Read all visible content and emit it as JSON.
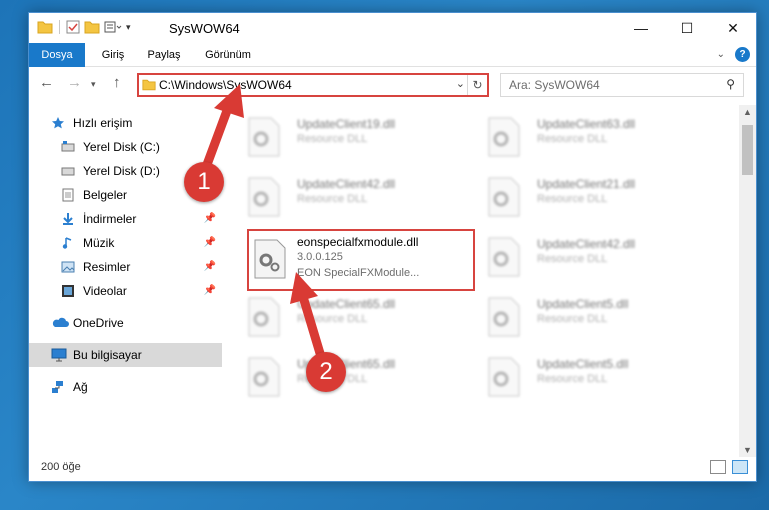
{
  "window": {
    "title": "SysWOW64"
  },
  "ribbon": {
    "tabs": [
      "Dosya",
      "Giriş",
      "Paylaş",
      "Görünüm"
    ]
  },
  "address": {
    "path": "C:\\Windows\\SysWOW64"
  },
  "search": {
    "placeholder": "Ara: SysWOW64"
  },
  "sidebar": {
    "items": [
      {
        "label": "Hızlı erişim",
        "icon": "star-icon"
      },
      {
        "label": "Yerel Disk (C:)",
        "icon": "drive-icon"
      },
      {
        "label": "Yerel Disk (D:)",
        "icon": "drive-icon"
      },
      {
        "label": "Belgeler",
        "icon": "documents-icon"
      },
      {
        "label": "İndirmeler",
        "icon": "download-icon",
        "pinned": true
      },
      {
        "label": "Müzik",
        "icon": "music-icon",
        "pinned": true
      },
      {
        "label": "Resimler",
        "icon": "pictures-icon",
        "pinned": true
      },
      {
        "label": "Videolar",
        "icon": "videos-icon",
        "pinned": true
      },
      {
        "label": "OneDrive",
        "icon": "cloud-icon"
      },
      {
        "label": "Bu bilgisayar",
        "icon": "computer-icon",
        "selected": true
      },
      {
        "label": "Ağ",
        "icon": "network-icon"
      }
    ]
  },
  "files": [
    {
      "name": "UpdateClient19.dll",
      "desc": "Resource DLL"
    },
    {
      "name": "UpdateClient63.dll",
      "desc": "Resource DLL"
    },
    {
      "name": "UpdateClient42.dll",
      "desc": "Resource DLL"
    },
    {
      "name": "UpdateClient21.dll",
      "desc": "Resource DLL"
    },
    {
      "name": "eonspecialfxmodule.dll",
      "version": "3.0.0.125",
      "desc": "EON SpecialFXModule...",
      "highlighted": true
    },
    {
      "name": "UpdateClient42.dll",
      "desc": "Resource DLL"
    },
    {
      "name": "UpdateClient65.dll",
      "desc": "Resource DLL"
    },
    {
      "name": "UpdateClient5.dll",
      "desc": "Resource DLL"
    },
    {
      "name": "UpdateClient65.dll",
      "desc": "Resource DLL"
    },
    {
      "name": "UpdateClient5.dll",
      "desc": "Resource DLL"
    }
  ],
  "status": {
    "count": "200 öğe"
  },
  "annotations": {
    "step1": "1",
    "step2": "2"
  },
  "colors": {
    "accent": "#1979ca",
    "highlight": "#d7443f",
    "desktop": "#1d74b8"
  }
}
